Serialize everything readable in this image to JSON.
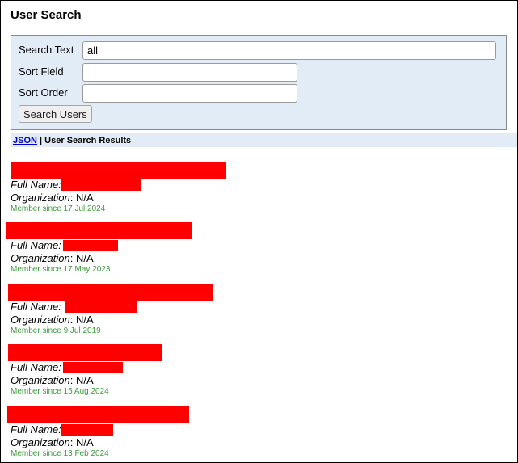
{
  "page": {
    "title": "User Search"
  },
  "form": {
    "search_text_label": "Search Text",
    "search_text_value": "all",
    "sort_field_label": "Sort Field",
    "sort_field_value": "",
    "sort_order_label": "Sort Order",
    "sort_order_value": "",
    "search_button": "Search Users"
  },
  "results": {
    "json_link": "JSON",
    "separator": " | ",
    "title": "User Search Results"
  },
  "labels": {
    "full_name": "Full Name:",
    "organization": "Organization",
    "org_sep": ": "
  },
  "users": [
    {
      "full_name": "",
      "organization": "N/A",
      "member_since": "Member since 17 Jul 2024"
    },
    {
      "full_name": "",
      "organization": "N/A",
      "member_since": "Member since 17 May 2023"
    },
    {
      "full_name": "",
      "organization": "N/A",
      "member_since": "Member since 9 Jul 2019"
    },
    {
      "full_name": "",
      "organization": "N/A",
      "member_since": "Member since 15 Aug 2024"
    },
    {
      "full_name": "",
      "organization": "N/A",
      "member_since": "Member since 13 Feb 2024"
    }
  ],
  "colors": {
    "form_background": "#e2ecf6",
    "redaction": "#ff0000",
    "member_since": "#3b9a3b",
    "link": "#0000cc"
  }
}
